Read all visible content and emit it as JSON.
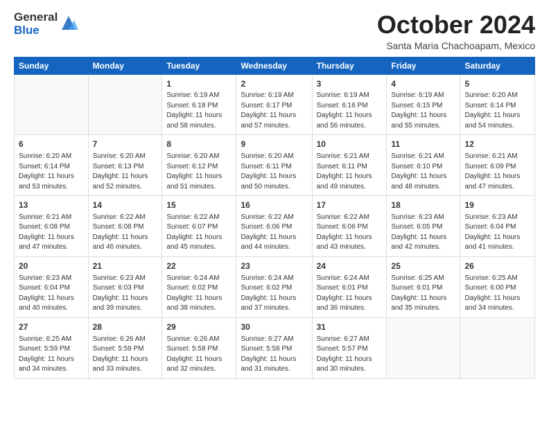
{
  "logo": {
    "general": "General",
    "blue": "Blue"
  },
  "header": {
    "month": "October 2024",
    "location": "Santa Maria Chachoapam, Mexico"
  },
  "weekdays": [
    "Sunday",
    "Monday",
    "Tuesday",
    "Wednesday",
    "Thursday",
    "Friday",
    "Saturday"
  ],
  "weeks": [
    [
      {
        "day": "",
        "info": ""
      },
      {
        "day": "",
        "info": ""
      },
      {
        "day": "1",
        "info": "Sunrise: 6:19 AM\nSunset: 6:18 PM\nDaylight: 11 hours and 58 minutes."
      },
      {
        "day": "2",
        "info": "Sunrise: 6:19 AM\nSunset: 6:17 PM\nDaylight: 11 hours and 57 minutes."
      },
      {
        "day": "3",
        "info": "Sunrise: 6:19 AM\nSunset: 6:16 PM\nDaylight: 11 hours and 56 minutes."
      },
      {
        "day": "4",
        "info": "Sunrise: 6:19 AM\nSunset: 6:15 PM\nDaylight: 11 hours and 55 minutes."
      },
      {
        "day": "5",
        "info": "Sunrise: 6:20 AM\nSunset: 6:14 PM\nDaylight: 11 hours and 54 minutes."
      }
    ],
    [
      {
        "day": "6",
        "info": "Sunrise: 6:20 AM\nSunset: 6:14 PM\nDaylight: 11 hours and 53 minutes."
      },
      {
        "day": "7",
        "info": "Sunrise: 6:20 AM\nSunset: 6:13 PM\nDaylight: 11 hours and 52 minutes."
      },
      {
        "day": "8",
        "info": "Sunrise: 6:20 AM\nSunset: 6:12 PM\nDaylight: 11 hours and 51 minutes."
      },
      {
        "day": "9",
        "info": "Sunrise: 6:20 AM\nSunset: 6:11 PM\nDaylight: 11 hours and 50 minutes."
      },
      {
        "day": "10",
        "info": "Sunrise: 6:21 AM\nSunset: 6:11 PM\nDaylight: 11 hours and 49 minutes."
      },
      {
        "day": "11",
        "info": "Sunrise: 6:21 AM\nSunset: 6:10 PM\nDaylight: 11 hours and 48 minutes."
      },
      {
        "day": "12",
        "info": "Sunrise: 6:21 AM\nSunset: 6:09 PM\nDaylight: 11 hours and 47 minutes."
      }
    ],
    [
      {
        "day": "13",
        "info": "Sunrise: 6:21 AM\nSunset: 6:08 PM\nDaylight: 11 hours and 47 minutes."
      },
      {
        "day": "14",
        "info": "Sunrise: 6:22 AM\nSunset: 6:08 PM\nDaylight: 11 hours and 46 minutes."
      },
      {
        "day": "15",
        "info": "Sunrise: 6:22 AM\nSunset: 6:07 PM\nDaylight: 11 hours and 45 minutes."
      },
      {
        "day": "16",
        "info": "Sunrise: 6:22 AM\nSunset: 6:06 PM\nDaylight: 11 hours and 44 minutes."
      },
      {
        "day": "17",
        "info": "Sunrise: 6:22 AM\nSunset: 6:06 PM\nDaylight: 11 hours and 43 minutes."
      },
      {
        "day": "18",
        "info": "Sunrise: 6:23 AM\nSunset: 6:05 PM\nDaylight: 11 hours and 42 minutes."
      },
      {
        "day": "19",
        "info": "Sunrise: 6:23 AM\nSunset: 6:04 PM\nDaylight: 11 hours and 41 minutes."
      }
    ],
    [
      {
        "day": "20",
        "info": "Sunrise: 6:23 AM\nSunset: 6:04 PM\nDaylight: 11 hours and 40 minutes."
      },
      {
        "day": "21",
        "info": "Sunrise: 6:23 AM\nSunset: 6:03 PM\nDaylight: 11 hours and 39 minutes."
      },
      {
        "day": "22",
        "info": "Sunrise: 6:24 AM\nSunset: 6:02 PM\nDaylight: 11 hours and 38 minutes."
      },
      {
        "day": "23",
        "info": "Sunrise: 6:24 AM\nSunset: 6:02 PM\nDaylight: 11 hours and 37 minutes."
      },
      {
        "day": "24",
        "info": "Sunrise: 6:24 AM\nSunset: 6:01 PM\nDaylight: 11 hours and 36 minutes."
      },
      {
        "day": "25",
        "info": "Sunrise: 6:25 AM\nSunset: 6:01 PM\nDaylight: 11 hours and 35 minutes."
      },
      {
        "day": "26",
        "info": "Sunrise: 6:25 AM\nSunset: 6:00 PM\nDaylight: 11 hours and 34 minutes."
      }
    ],
    [
      {
        "day": "27",
        "info": "Sunrise: 6:25 AM\nSunset: 5:59 PM\nDaylight: 11 hours and 34 minutes."
      },
      {
        "day": "28",
        "info": "Sunrise: 6:26 AM\nSunset: 5:59 PM\nDaylight: 11 hours and 33 minutes."
      },
      {
        "day": "29",
        "info": "Sunrise: 6:26 AM\nSunset: 5:58 PM\nDaylight: 11 hours and 32 minutes."
      },
      {
        "day": "30",
        "info": "Sunrise: 6:27 AM\nSunset: 5:58 PM\nDaylight: 11 hours and 31 minutes."
      },
      {
        "day": "31",
        "info": "Sunrise: 6:27 AM\nSunset: 5:57 PM\nDaylight: 11 hours and 30 minutes."
      },
      {
        "day": "",
        "info": ""
      },
      {
        "day": "",
        "info": ""
      }
    ]
  ]
}
